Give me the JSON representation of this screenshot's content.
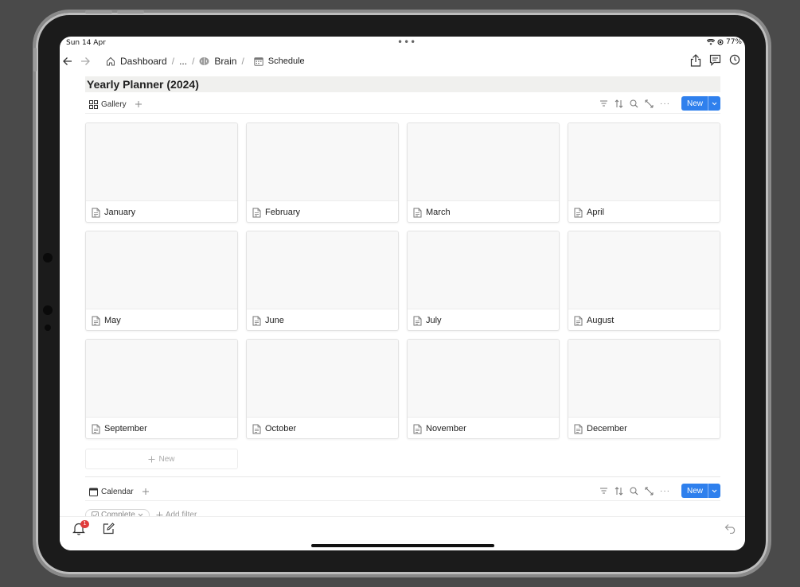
{
  "status": {
    "time": "Sun 14 Apr",
    "battery": "77%"
  },
  "breadcrumb": {
    "items": [
      "Dashboard",
      "...",
      "Brain",
      "Schedule"
    ]
  },
  "page": {
    "title": "Yearly Planner (2024)"
  },
  "gallery_view": {
    "label": "Gallery",
    "new_label": "New"
  },
  "cards": [
    "January",
    "February",
    "March",
    "April",
    "May",
    "June",
    "July",
    "August",
    "September",
    "October",
    "November",
    "December"
  ],
  "add_new": "New",
  "calendar_view": {
    "label": "Calendar",
    "new_label": "New"
  },
  "filters": {
    "chip": "Complete",
    "add_filter": "Add filter"
  },
  "notifications": {
    "count": "1"
  },
  "colors": {
    "accent": "#2f80ed",
    "badge": "#e03c3c",
    "title_bg": "#f0f0ee"
  },
  "icons": [
    "back-arrow-icon",
    "forward-arrow-icon",
    "home-icon",
    "brain-icon",
    "calendar-icon",
    "share-icon",
    "comment-icon",
    "history-icon",
    "gallery-grid-icon",
    "plus-icon",
    "filter-icon",
    "sort-icon",
    "search-icon",
    "expand-icon",
    "more-icon",
    "chevron-down-icon",
    "page-icon",
    "bell-icon",
    "compose-icon",
    "undo-icon"
  ]
}
